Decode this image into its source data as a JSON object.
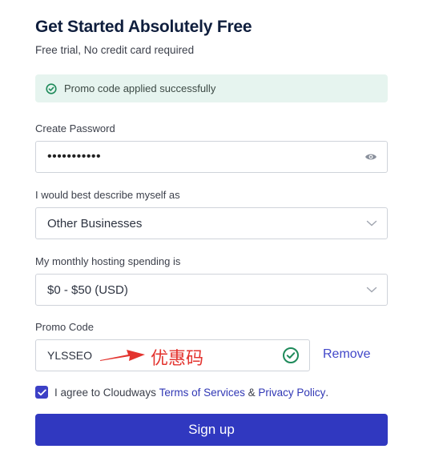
{
  "header": {
    "title": "Get Started Absolutely Free",
    "subtitle": "Free trial, No credit card required"
  },
  "alert": {
    "message": "Promo code applied successfully",
    "icon": "check-circle-icon",
    "color": "#e6f4ef"
  },
  "password": {
    "label": "Create Password",
    "masked_value": "•••••••••••",
    "icon": "eye-icon"
  },
  "describe": {
    "label": "I would best describe myself as",
    "selected": "Other Businesses",
    "icon": "chevron-down-icon"
  },
  "spending": {
    "label": "My monthly hosting spending is",
    "selected": "$0 - $50 (USD)",
    "icon": "chevron-down-icon"
  },
  "promo": {
    "label": "Promo Code",
    "value": "YLSSEO",
    "annotation": "优惠码",
    "remove_label": "Remove",
    "valid_icon": "check-circle-icon"
  },
  "agree": {
    "checked": true,
    "text_before": "I agree to Cloudways ",
    "terms_link": "Terms of Services",
    "text_between": " & ",
    "privacy_link": "Privacy Policy",
    "text_after": "."
  },
  "signup": {
    "label": "Sign up",
    "color": "#3038c0"
  }
}
